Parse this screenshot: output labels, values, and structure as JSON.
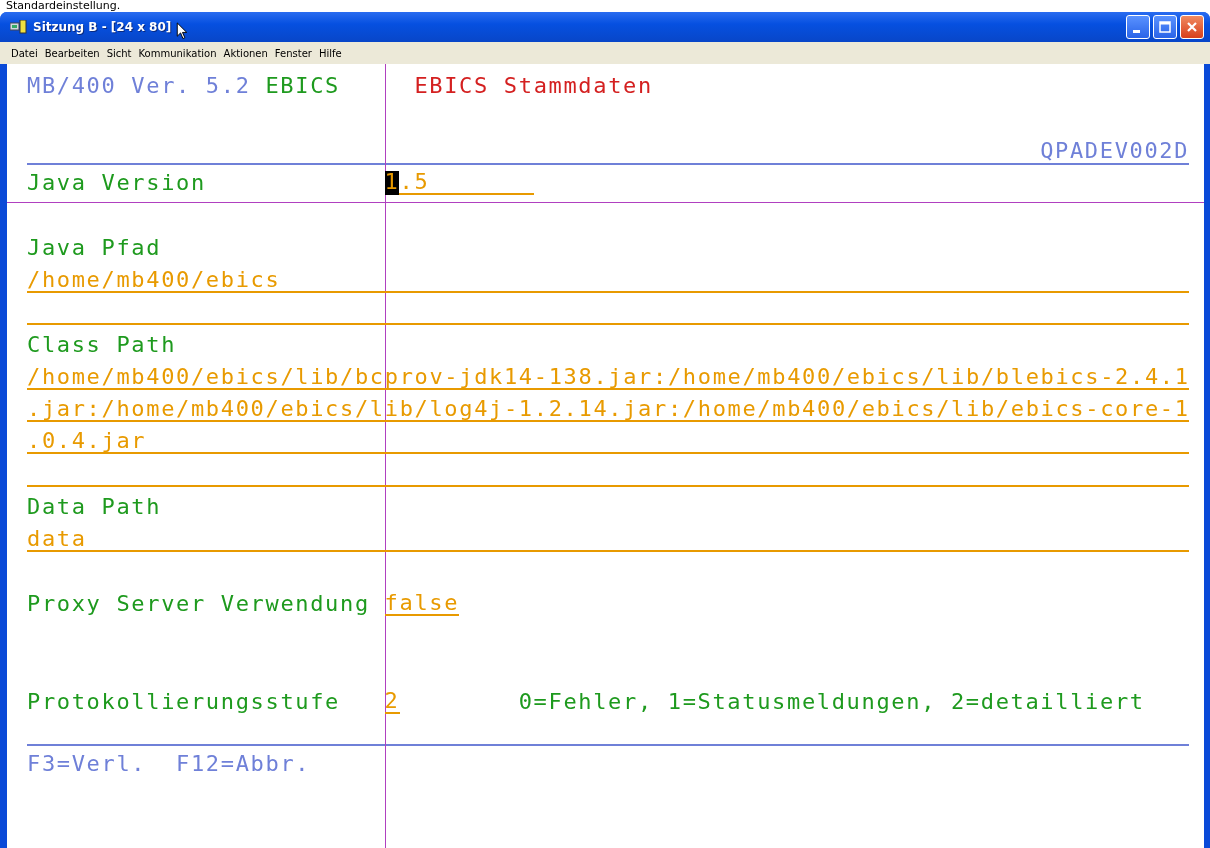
{
  "top_caption": "Standardeinstellung.",
  "window": {
    "title": "Sitzung B - [24 x 80]"
  },
  "menu": [
    "Datei",
    "Bearbeiten",
    "Sicht",
    "Kommunikation",
    "Aktionen",
    "Fenster",
    "Hilfe"
  ],
  "terminal": {
    "header": {
      "product": "MB/400 Ver. 5.2",
      "module": "EBICS",
      "title": "EBICS Stammdaten",
      "screen_id": "QPADEV002D"
    },
    "entries": [
      {
        "kind": "inline_fixed",
        "label": "Java Version",
        "value": "1.5",
        "cursor": true
      },
      {
        "kind": "block",
        "label": "Java Pfad",
        "lines": [
          {
            "kind": "filled",
            "text": "/home/mb400/ebics"
          },
          {
            "kind": "blank"
          }
        ]
      },
      {
        "kind": "block",
        "label": "Class Path",
        "lines": [
          {
            "kind": "filled",
            "text": "/home/mb400/ebics/lib/bcprov-jdk14-138.jar:/home/mb400/ebics/lib/blebics-2.4.1"
          },
          {
            "kind": "filled",
            "text": ".jar:/home/mb400/ebics/lib/log4j-1.2.14.jar:/home/mb400/ebics/lib/ebics-core-1"
          },
          {
            "kind": "filled",
            "text": ".0.4.jar"
          },
          {
            "kind": "blank"
          }
        ]
      },
      {
        "kind": "block",
        "label": "Data Path",
        "lines": [
          {
            "kind": "filled",
            "text": "data"
          }
        ]
      },
      {
        "kind": "inline",
        "label": "Proxy Server Verwendung",
        "value": "false",
        "cursor": false
      },
      {
        "kind": "inline",
        "label": "Protokollierungsstufe",
        "value": "2",
        "cursor": false,
        "hint": "0=Fehler, 1=Statusmeldungen, 2=detailliert"
      }
    ],
    "function_keys": [
      "F3=Verl.",
      "F12=Abbr."
    ]
  }
}
